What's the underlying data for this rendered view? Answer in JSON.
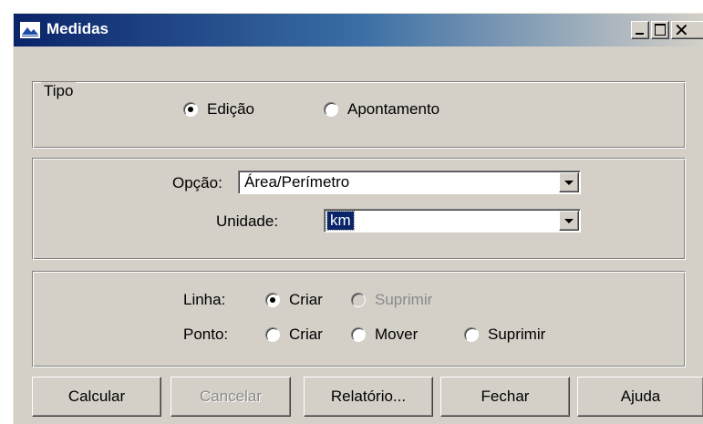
{
  "window": {
    "title": "Medidas"
  },
  "titlebar_icons": {
    "minimize": "minimize-icon",
    "maximize": "maximize-icon",
    "close": "close-icon"
  },
  "tipo": {
    "legend": "Tipo",
    "options": [
      {
        "label": "Edição",
        "checked": true
      },
      {
        "label": "Apontamento",
        "checked": false
      }
    ]
  },
  "opcao": {
    "label": "Opção:",
    "value": "Área/Perímetro"
  },
  "unidade": {
    "label": "Unidade:",
    "value": "km"
  },
  "linha": {
    "label": "Linha:",
    "options": [
      {
        "label": "Criar",
        "checked": true,
        "enabled": true
      },
      {
        "label": "Suprimir",
        "checked": false,
        "enabled": false
      }
    ]
  },
  "ponto": {
    "label": "Ponto:",
    "options": [
      {
        "label": "Criar",
        "checked": false
      },
      {
        "label": "Mover",
        "checked": false
      },
      {
        "label": "Suprimir",
        "checked": false
      }
    ]
  },
  "buttons": {
    "calcular": "Calcular",
    "cancelar": "Cancelar",
    "relatorio": "Relatório...",
    "fechar": "Fechar",
    "ajuda": "Ajuda"
  }
}
